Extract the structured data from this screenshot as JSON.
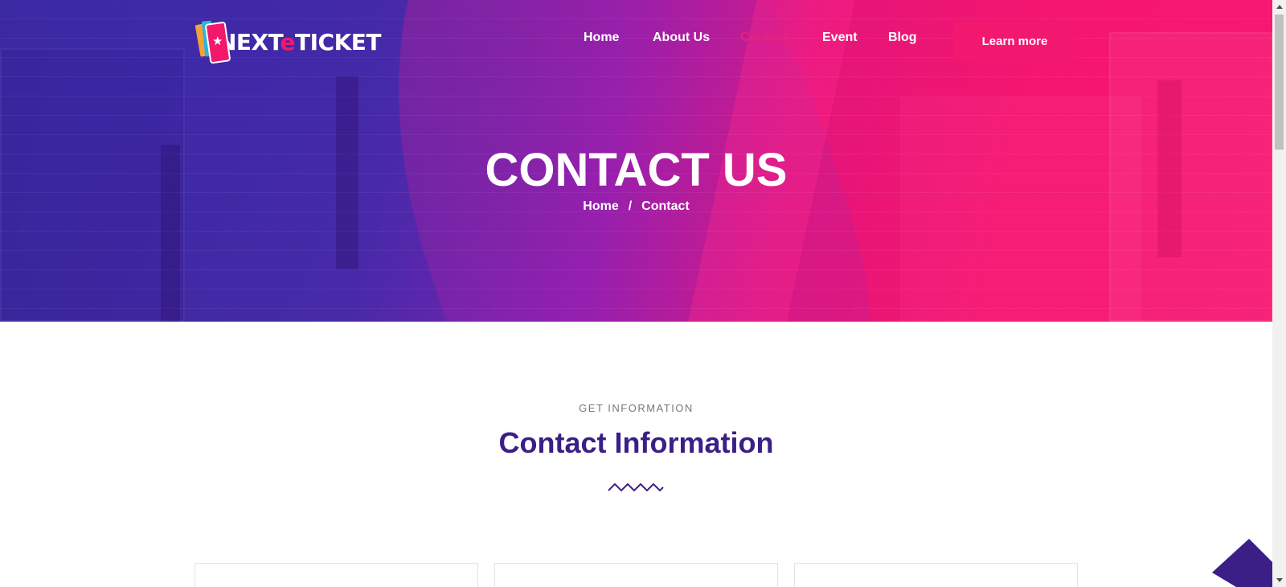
{
  "brand": {
    "name_prefix": "NEXT",
    "name_accent": "e",
    "name_suffix": "TICKET",
    "accent_color": "#f2196c"
  },
  "nav": {
    "items": [
      {
        "label": "Home"
      },
      {
        "label": "About Us"
      },
      {
        "label": "Contact",
        "active": true
      },
      {
        "label": "Event"
      },
      {
        "label": "Blog"
      }
    ],
    "cta_label": "Learn more"
  },
  "hero": {
    "title": "CONTACT US",
    "breadcrumb": {
      "home": "Home",
      "separator": "/",
      "current": "Contact"
    }
  },
  "section": {
    "eyebrow": "GET INFORMATION",
    "title": "Contact Information",
    "title_color": "#3b1f86"
  },
  "icons": {
    "scroll_top": "arrow-up-icon",
    "divider": "zigzag-divider-icon"
  }
}
